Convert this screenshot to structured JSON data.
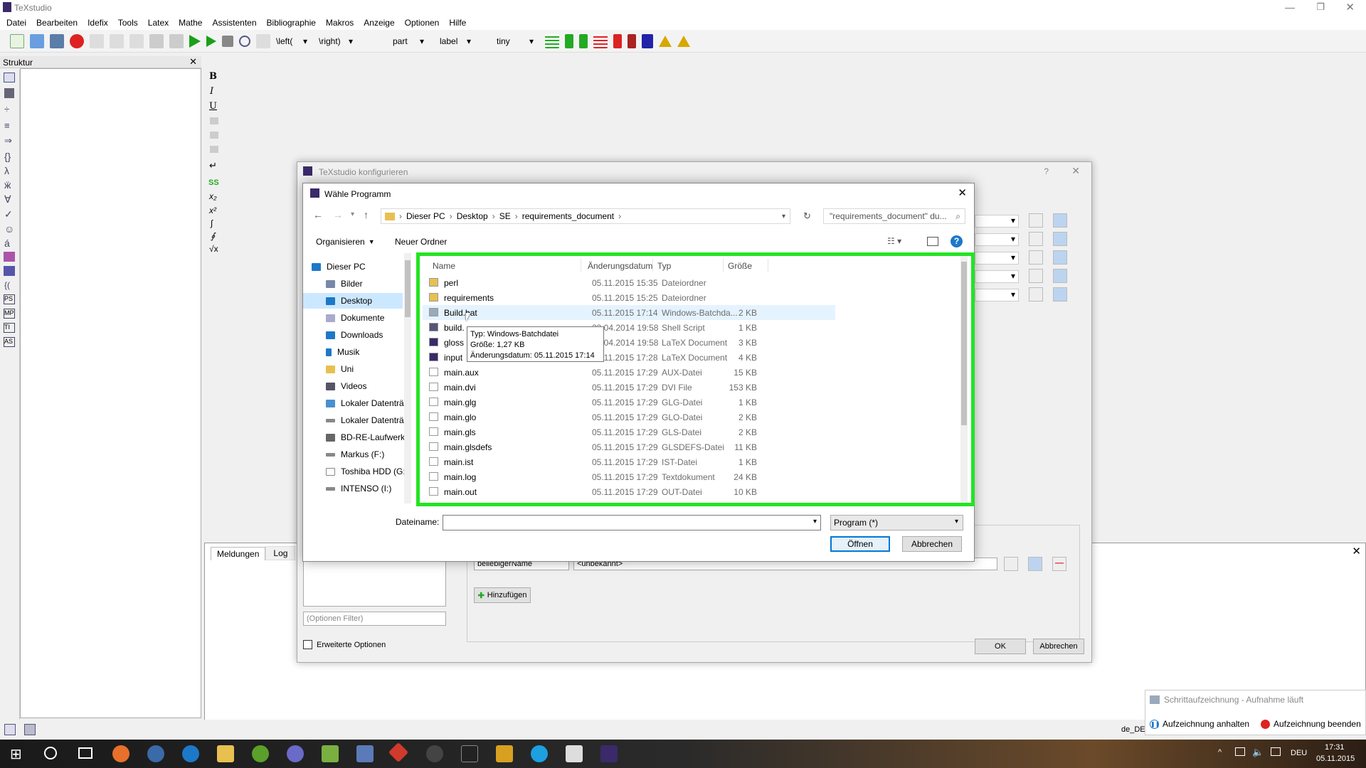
{
  "app": {
    "title": "TeXstudio"
  },
  "menu": [
    "Datei",
    "Bearbeiten",
    "Idefix",
    "Tools",
    "Latex",
    "Mathe",
    "Assistenten",
    "Bibliographie",
    "Makros",
    "Anzeige",
    "Optionen",
    "Hilfe"
  ],
  "toolbar": {
    "left_combo": "\\left(",
    "right_combo": "\\right)",
    "part_combo": "part",
    "label_combo": "label",
    "size_combo": "tiny"
  },
  "structure": {
    "title": "Struktur"
  },
  "messages": {
    "tabs": [
      "Meldungen",
      "Log"
    ]
  },
  "status": {
    "language": "de_DE"
  },
  "config_dialog": {
    "title": "TeXstudio konfigurieren",
    "option_filter_placeholder": "(Optionen Filter)",
    "advanced_label": "Erweiterte Optionen",
    "cmd_name": "beliebigerName",
    "cmd_value": "<unbekannt>",
    "add_label": "Hinzufügen",
    "ok_label": "OK",
    "cancel_label": "Abbrechen"
  },
  "file_dialog": {
    "title": "Wähle Programm",
    "breadcrumb": [
      "Dieser PC",
      "Desktop",
      "SE",
      "requirements_document"
    ],
    "search_placeholder": "\"requirements_document\" du...",
    "organize_label": "Organisieren",
    "new_folder_label": "Neuer Ordner",
    "nav": [
      "Dieser PC",
      "Bilder",
      "Desktop",
      "Dokumente",
      "Downloads",
      "Musik",
      "Uni",
      "Videos",
      "Lokaler Datenträ",
      "Lokaler Datenträ",
      "BD-RE-Laufwerk",
      "Markus (F:)",
      "Toshiba HDD (G:",
      "INTENSO (I:)"
    ],
    "columns": {
      "name": "Name",
      "date": "Änderungsdatum",
      "type": "Typ",
      "size": "Größe"
    },
    "files": [
      {
        "name": "perl",
        "date": "05.11.2015 15:35",
        "type": "Dateiordner",
        "size": ""
      },
      {
        "name": "requirements",
        "date": "05.11.2015 15:25",
        "type": "Dateiordner",
        "size": ""
      },
      {
        "name": "Build.bat",
        "date": "05.11.2015 17:14",
        "type": "Windows-Batchda...",
        "size": "2 KB"
      },
      {
        "name": "build.",
        "date": "23.04.2014 19:58",
        "type": "Shell Script",
        "size": "1 KB"
      },
      {
        "name": "gloss",
        "date": "23.04.2014 19:58",
        "type": "LaTeX Document",
        "size": "3 KB"
      },
      {
        "name": "input",
        "date": "05.11.2015 17:28",
        "type": "LaTeX Document",
        "size": "4 KB"
      },
      {
        "name": "main.aux",
        "date": "05.11.2015 17:29",
        "type": "AUX-Datei",
        "size": "15 KB"
      },
      {
        "name": "main.dvi",
        "date": "05.11.2015 17:29",
        "type": "DVI File",
        "size": "153 KB"
      },
      {
        "name": "main.glg",
        "date": "05.11.2015 17:29",
        "type": "GLG-Datei",
        "size": "1 KB"
      },
      {
        "name": "main.glo",
        "date": "05.11.2015 17:29",
        "type": "GLO-Datei",
        "size": "2 KB"
      },
      {
        "name": "main.gls",
        "date": "05.11.2015 17:29",
        "type": "GLS-Datei",
        "size": "2 KB"
      },
      {
        "name": "main.glsdefs",
        "date": "05.11.2015 17:29",
        "type": "GLSDEFS-Datei",
        "size": "11 KB"
      },
      {
        "name": "main.ist",
        "date": "05.11.2015 17:29",
        "type": "IST-Datei",
        "size": "1 KB"
      },
      {
        "name": "main.log",
        "date": "05.11.2015 17:29",
        "type": "Textdokument",
        "size": "24 KB"
      },
      {
        "name": "main.out",
        "date": "05.11.2015 17:29",
        "type": "OUT-Datei",
        "size": "10 KB"
      }
    ],
    "tooltip": {
      "line1": "Typ: Windows-Batchdatei",
      "line2": "Größe: 1,27 KB",
      "line3": "Änderungsdatum: 05.11.2015 17:14"
    },
    "filename_label": "Dateiname:",
    "filename_value": "",
    "filter_value": "Program (*)",
    "open_label": "Öffnen",
    "cancel_label": "Abbrechen"
  },
  "notification": {
    "title": "Schrittaufzeichnung - Aufnahme läuft",
    "pause_label": "Aufzeichnung anhalten",
    "stop_label": "Aufzeichnung beenden"
  },
  "taskbar": {
    "time": "17:31",
    "date": "05.11.2015",
    "lang": "DEU"
  },
  "colors": {
    "highlight": "#22e422",
    "selection": "#cce8ff",
    "accent": "#0078d7"
  }
}
